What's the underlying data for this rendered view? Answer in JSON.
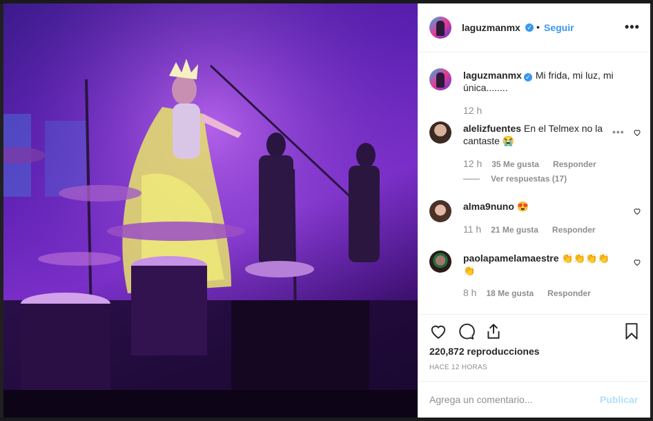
{
  "header": {
    "username": "laguzmanmx",
    "separator": "•",
    "follow_label": "Seguir",
    "more_label": "•••"
  },
  "caption": {
    "username": "laguzmanmx",
    "text": "Mi frida, mi luz, mi única........",
    "time": "12 h"
  },
  "comments": [
    {
      "username": "alelizfuentes",
      "text": "En el Telmex no la cantaste 😭",
      "time": "12 h",
      "likes": "35 Me gusta",
      "reply": "Responder",
      "view_replies": "Ver respuestas (17)",
      "more": "•••"
    },
    {
      "username": "alma9nuno",
      "text": "😍",
      "time": "11 h",
      "likes": "21 Me gusta",
      "reply": "Responder"
    },
    {
      "username": "paolapamelamaestre",
      "text": "👏👏👏👏👏",
      "time": "8 h",
      "likes": "18 Me gusta",
      "reply": "Responder"
    }
  ],
  "actions": {
    "like_icon": "heart-outline-icon",
    "comment_icon": "comment-bubble-icon",
    "share_icon": "share-upload-icon",
    "save_icon": "bookmark-icon",
    "views": "220,872 reproducciones",
    "ago": "HACE 12 HORAS"
  },
  "add_comment": {
    "placeholder": "Agrega un comentario...",
    "publish_label": "Publicar"
  },
  "colors": {
    "link": "#3897f0",
    "muted": "#8e8e8e",
    "publish_disabled": "#b2dffc"
  }
}
